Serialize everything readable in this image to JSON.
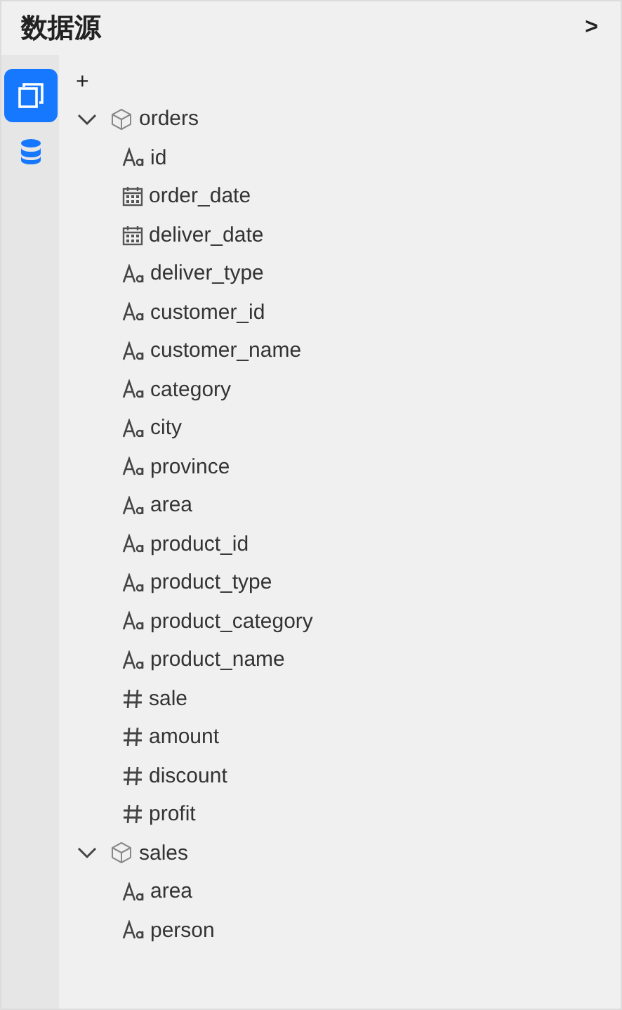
{
  "panel": {
    "title": "数据源",
    "collapse": ">"
  },
  "rail_tabs": [
    {
      "kind": "copies",
      "selected": true
    },
    {
      "kind": "database",
      "selected": false
    }
  ],
  "add_button": "+",
  "tables": [
    {
      "name": "orders",
      "expanded": true,
      "fields": [
        {
          "name": "id",
          "kind": "text"
        },
        {
          "name": "order_date",
          "kind": "date"
        },
        {
          "name": "deliver_date",
          "kind": "date"
        },
        {
          "name": "deliver_type",
          "kind": "text"
        },
        {
          "name": "customer_id",
          "kind": "text"
        },
        {
          "name": "customer_name",
          "kind": "text"
        },
        {
          "name": "category",
          "kind": "text"
        },
        {
          "name": "city",
          "kind": "text"
        },
        {
          "name": "province",
          "kind": "text"
        },
        {
          "name": "area",
          "kind": "text"
        },
        {
          "name": "product_id",
          "kind": "text"
        },
        {
          "name": "product_type",
          "kind": "text"
        },
        {
          "name": "product_category",
          "kind": "text"
        },
        {
          "name": "product_name",
          "kind": "text"
        },
        {
          "name": "sale",
          "kind": "number"
        },
        {
          "name": "amount",
          "kind": "number"
        },
        {
          "name": "discount",
          "kind": "number"
        },
        {
          "name": "profit",
          "kind": "number"
        }
      ]
    },
    {
      "name": "sales",
      "expanded": true,
      "fields": [
        {
          "name": "area",
          "kind": "text"
        },
        {
          "name": "person",
          "kind": "text"
        }
      ]
    }
  ]
}
